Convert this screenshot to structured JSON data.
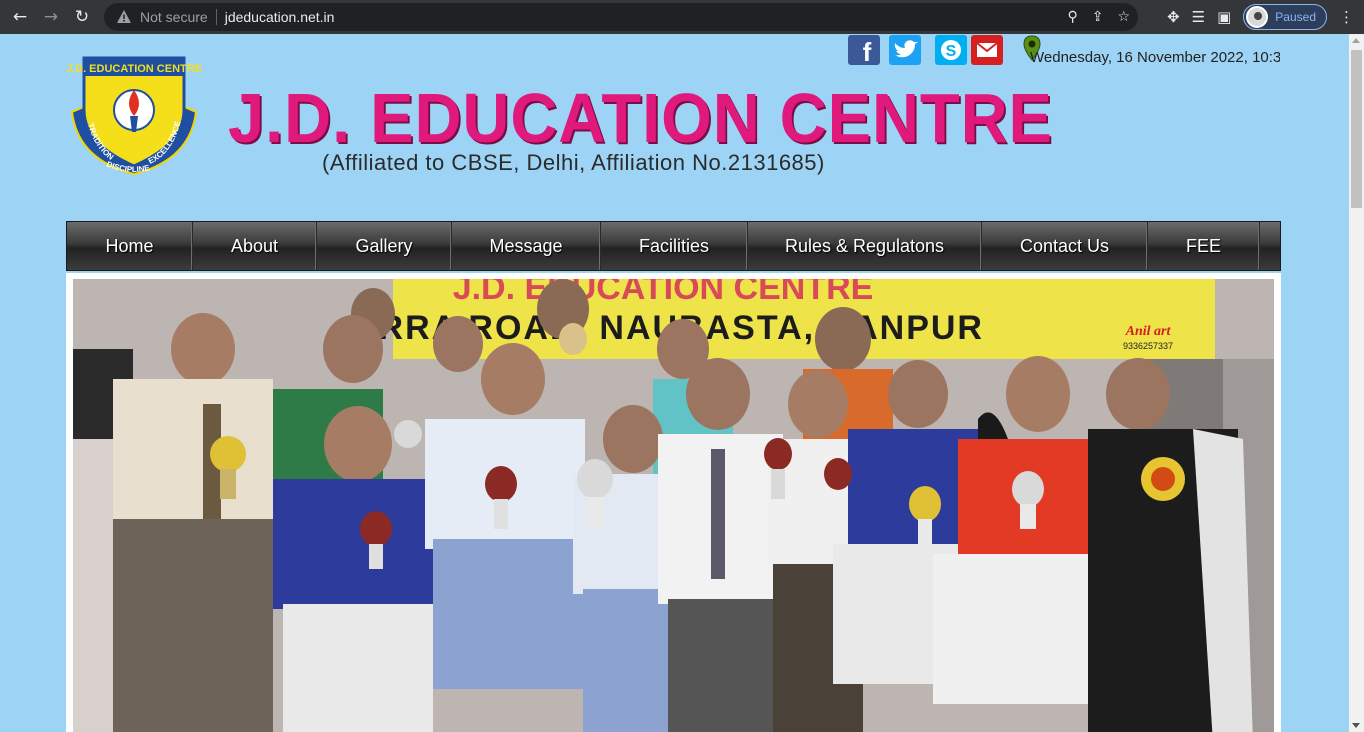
{
  "browser": {
    "security_label": "Not secure",
    "url": "jdeducation.net.in",
    "profile_status": "Paused"
  },
  "header": {
    "title": "J.D. EDUCATION CENTRE",
    "affiliation": "(Affiliated to CBSE, Delhi, Affiliation No.2131685)",
    "logo": {
      "top_text": "J.D. EDUCATION CENTRE",
      "left_text": "TRADITION",
      "right_text": "EXCELLENCE",
      "bottom_text": "DISCIPLINE"
    },
    "date_text": "Wednesday, 16 November 2022, 10:3"
  },
  "socials": [
    {
      "name": "facebook",
      "glyph": "f",
      "color": "#3b5998"
    },
    {
      "name": "twitter",
      "glyph": "t",
      "color": "#1da1f2"
    },
    {
      "name": "skype",
      "glyph": "S",
      "color": "#00aff0"
    },
    {
      "name": "email",
      "glyph": "✉",
      "color": "#d62020"
    }
  ],
  "menu": {
    "items": [
      "Home",
      "About",
      "Gallery",
      "Message",
      "Facilities",
      "Rules & Regulatons",
      "Contact Us",
      "FEE"
    ]
  },
  "banner": {
    "line1": "J.D. EDUCATION CENTRE",
    "line2": "ARRA ROAD, NAUBASTA, KANPUR",
    "brand": "Anil art",
    "phone": "9336257337"
  },
  "colors": {
    "page_bg": "#9dd4f5",
    "title": "#e0197d",
    "menu_bg": "#333333"
  }
}
